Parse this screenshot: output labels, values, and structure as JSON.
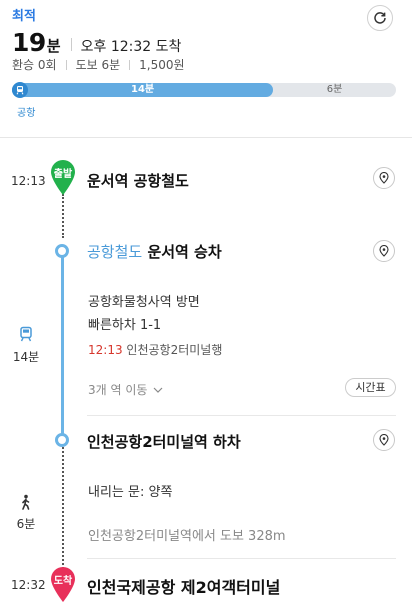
{
  "summary": {
    "badge": "최적",
    "duration_num": "19",
    "duration_unit": "분",
    "arrival": "오후 12:32 도착",
    "transfers": "환승 0회",
    "walk": "도보 6분",
    "fare": "1,500원",
    "bar_segment_1": "14분",
    "bar_segment_2": "6분",
    "bar_segment_1_fraction": 0.68,
    "bar_sub_label": "공항",
    "refresh_icon": "refresh-icon"
  },
  "route": {
    "start_time": "12:13",
    "start_pin": "출발",
    "start_name": "운서역 공항철도",
    "board_line": "공항철도",
    "board_station": "운서역 승차",
    "direction": "공항화물청사역 방면",
    "exit_info": "빠른하차 1-1",
    "departure_time": "12:13",
    "departure_dest": "인천공항2터미널행",
    "stations_count": "3개 역 이동",
    "timetable_label": "시간표",
    "ride_duration": "14분",
    "alight_station": "인천공항2터미널역 하차",
    "exit_door": "내리는 문: 양쪽",
    "walk_info": "인천공항2터미널역에서 도보 328m",
    "walk_duration": "6분",
    "end_time": "12:32",
    "end_pin": "도착",
    "end_name": "인천국제공항 제2여객터미널"
  },
  "colors": {
    "accent": "#2a7ae2",
    "line": "#6bb4e6",
    "start_pin": "#22b14c",
    "end_pin": "#e8305a",
    "departure_time": "#d6362c"
  }
}
